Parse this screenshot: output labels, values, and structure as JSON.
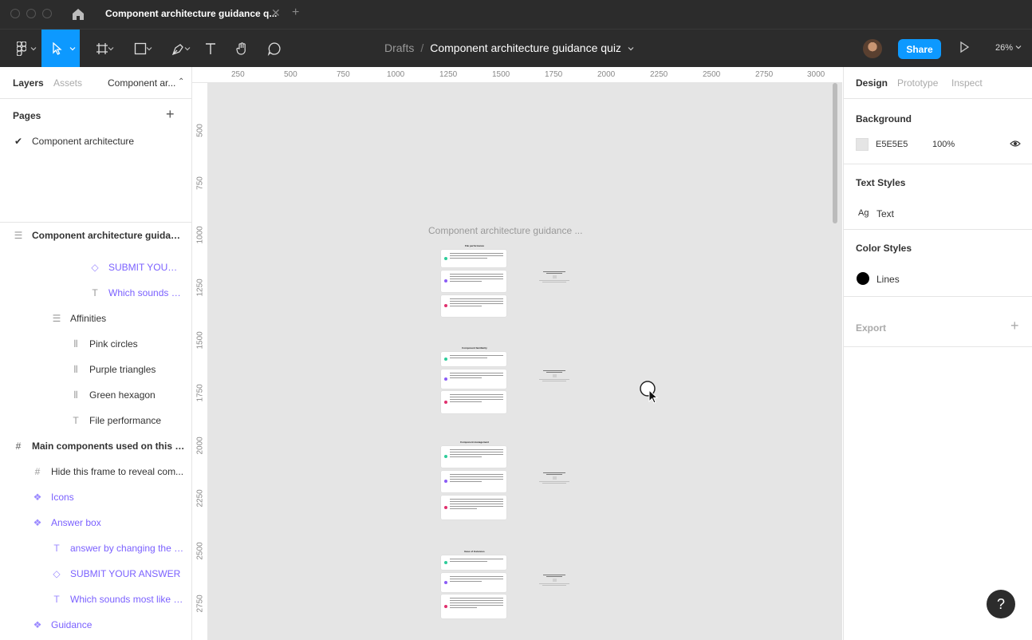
{
  "window": {
    "tab_title": "Component architecture guidance q...",
    "tab_close": "✕",
    "tab_add": "+"
  },
  "toolbar": {
    "breadcrumb_drafts": "Drafts",
    "breadcrumb_sep": "/",
    "breadcrumb_file": "Component architecture guidance quiz",
    "share_label": "Share",
    "zoom_label": "26%"
  },
  "left_panel": {
    "tab_layers": "Layers",
    "tab_assets": "Assets",
    "page_selector": "Component ar...",
    "pages_title": "Pages",
    "pages_add": "+",
    "current_page": "Component architecture",
    "layers": [
      {
        "label": "Component architecture guidanc...",
        "icon": "stack-frame-icon"
      },
      {
        "label": "SUBMIT YOUR ...",
        "icon": "instance-icon"
      },
      {
        "label": "Which sounds m...",
        "icon": "text-icon"
      },
      {
        "label": "Affinities",
        "icon": "stack-frame-icon"
      },
      {
        "label": "Pink circles",
        "icon": "columns-icon"
      },
      {
        "label": "Purple triangles",
        "icon": "columns-icon"
      },
      {
        "label": "Green hexagon",
        "icon": "columns-icon"
      },
      {
        "label": "File performance",
        "icon": "text-icon"
      },
      {
        "label": "Main components used on this pa...",
        "icon": "frame-icon"
      },
      {
        "label": "Hide this frame to reveal com...",
        "icon": "frame-icon"
      },
      {
        "label": "Icons",
        "icon": "component-icon"
      },
      {
        "label": "Answer box",
        "icon": "component-icon"
      },
      {
        "label": "answer by changing the v...",
        "icon": "text-icon"
      },
      {
        "label": "SUBMIT YOUR ANSWER",
        "icon": "instance-icon"
      },
      {
        "label": "Which sounds most like y...",
        "icon": "text-icon"
      },
      {
        "label": "Guidance",
        "icon": "component-icon"
      }
    ]
  },
  "canvas": {
    "ruler_top": [
      "250",
      "500",
      "750",
      "1000",
      "1250",
      "1500",
      "1750",
      "2000",
      "2250",
      "2500",
      "2750",
      "3000"
    ],
    "ruler_left": [
      "500",
      "750",
      "1000",
      "1250",
      "1500",
      "1750",
      "2000",
      "2250",
      "2500",
      "2750"
    ],
    "frame_name": "Component architecture guidance ...",
    "sections": [
      {
        "title": "File performance"
      },
      {
        "title": "Component familiarity"
      },
      {
        "title": "Component management"
      },
      {
        "title": "Ease of Instances"
      }
    ],
    "colors": {
      "green": "#2ecc9a",
      "purple": "#8b5cf6",
      "pink": "#e0306e"
    }
  },
  "right_panel": {
    "tab_design": "Design",
    "tab_prototype": "Prototype",
    "tab_inspect": "Inspect",
    "background_title": "Background",
    "background_hex": "E5E5E5",
    "background_opacity": "100%",
    "background_color": "#E5E5E5",
    "text_styles_title": "Text Styles",
    "text_style_ag": "Ag",
    "text_style_name": "Text",
    "color_styles_title": "Color Styles",
    "color_style_name": "Lines",
    "color_style_color": "#000000",
    "export_title": "Export",
    "export_add": "+"
  },
  "help": "?"
}
